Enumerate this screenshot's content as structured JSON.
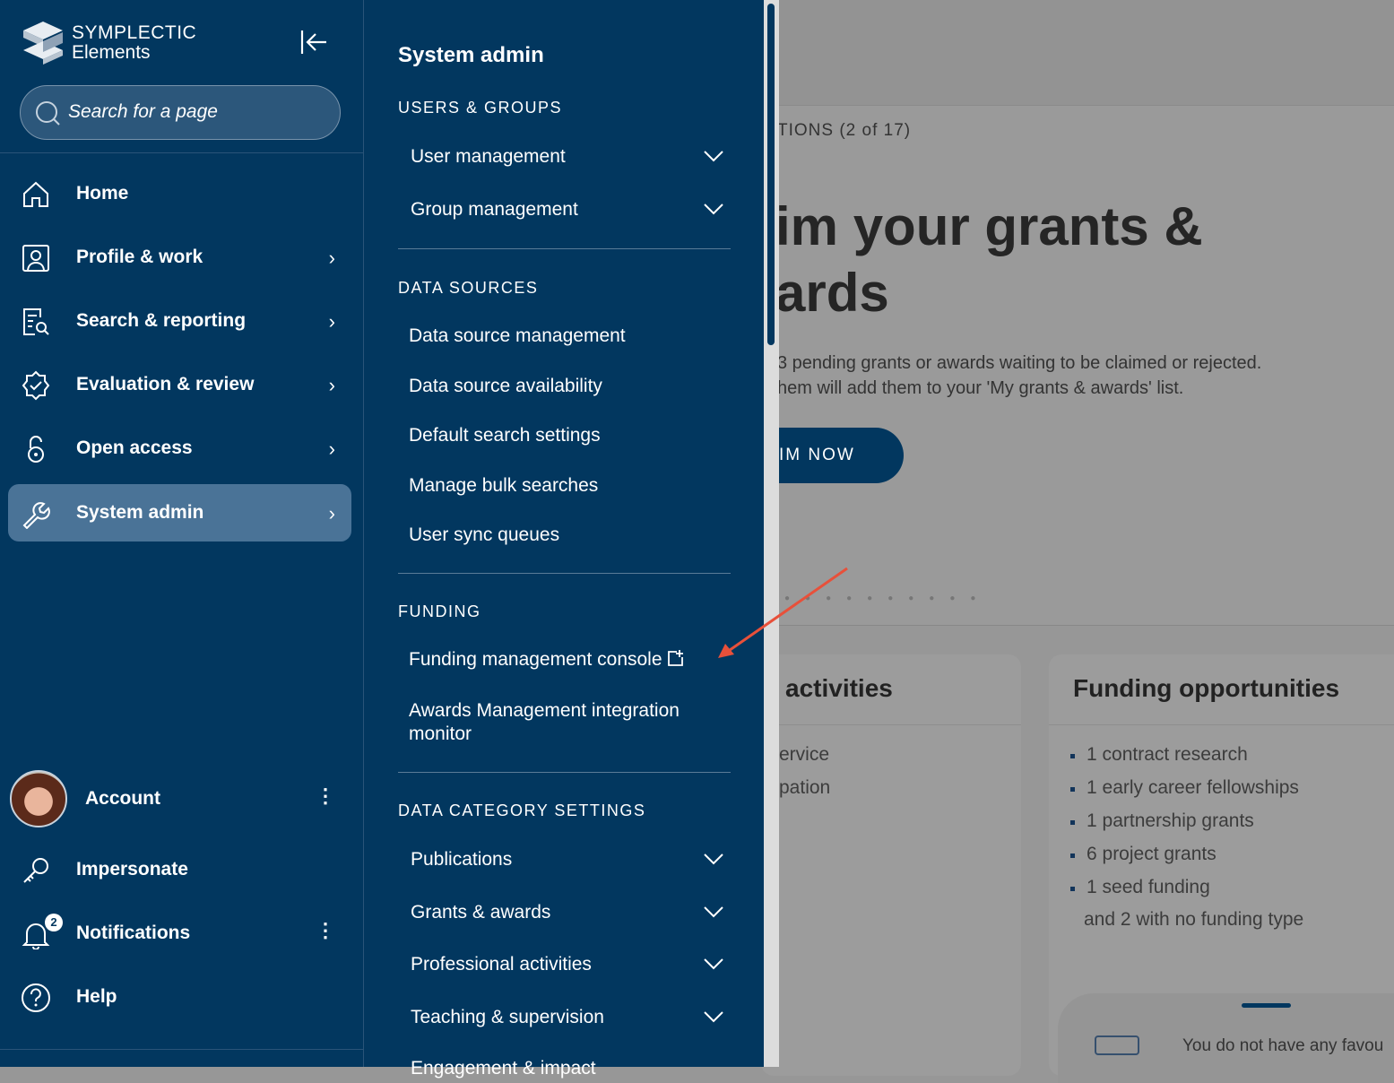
{
  "sidebar": {
    "logo": {
      "line1": "SYMPLECTIC",
      "line2": "Elements"
    },
    "search_placeholder": "Search for a page",
    "items": [
      {
        "label": "Home",
        "icon": "home-icon"
      },
      {
        "label": "Profile & work",
        "icon": "profile-icon"
      },
      {
        "label": "Search & reporting",
        "icon": "report-search-icon"
      },
      {
        "label": "Evaluation & review",
        "icon": "badge-check-icon"
      },
      {
        "label": "Open access",
        "icon": "lock-open-icon"
      },
      {
        "label": "System admin",
        "icon": "wrench-icon",
        "active": true
      }
    ],
    "bottom": [
      {
        "label": "Account"
      },
      {
        "label": "Impersonate"
      },
      {
        "label": "Notifications",
        "badge": "2"
      },
      {
        "label": "Help"
      }
    ]
  },
  "submenu": {
    "title": "System admin",
    "sections": [
      {
        "heading": "USERS & GROUPS",
        "items": [
          "User management",
          "Group management"
        ]
      },
      {
        "heading": "DATA SOURCES",
        "items": [
          "Data source management",
          "Data source availability",
          "Default search settings",
          "Manage bulk searches",
          "User sync queues"
        ]
      },
      {
        "heading": "FUNDING",
        "items": [
          "Funding management console",
          "Awards Management integration monitor"
        ]
      },
      {
        "heading": "DATA CATEGORY SETTINGS",
        "items": [
          "Publications",
          "Grants & awards",
          "Professional activities",
          "Teaching & supervision",
          "Engagement & impact"
        ]
      }
    ]
  },
  "background": {
    "carousel_label": "TIONS (2 of 17)",
    "headline1": "im your grants &",
    "headline2": "ards",
    "desc1": "3 pending grants or awards waiting to be claimed or rejected.",
    "desc2": "hem will add them to your 'My grants & awards' list.",
    "cta": "IM NOW",
    "card1_title": "activities",
    "card1_lines": [
      "ervice",
      "pation"
    ],
    "card2_title": "Funding opportunities",
    "card2_items": [
      "1 contract research",
      "1 early career fellowships",
      "1 partnership grants",
      "6 project grants",
      "1 seed funding"
    ],
    "card2_footer": "and 2 with no funding type",
    "favourites_text": "You do not have any favou"
  },
  "colors": {
    "sidebar": "#02375f",
    "active": "#4a7397",
    "annotation": "#e8503a"
  }
}
